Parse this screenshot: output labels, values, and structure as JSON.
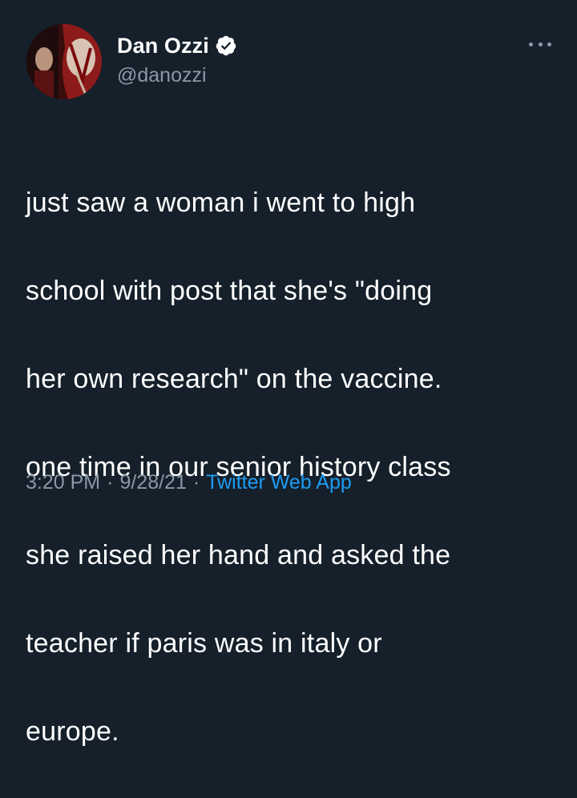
{
  "author": {
    "display_name": "Dan Ozzi",
    "handle": "@danozzi",
    "verified": true
  },
  "tweet": {
    "text_lines": [
      "just saw a woman i went to high",
      "school with post that she's \"doing",
      "her own research\" on the vaccine.",
      "one time in our senior history class",
      "she raised her hand and asked the",
      "teacher if paris was in italy or",
      "europe."
    ]
  },
  "meta": {
    "time": "3:20 PM",
    "separator": "·",
    "date": "9/28/21",
    "source": "Twitter Web App"
  },
  "colors": {
    "background": "#15202b",
    "secondary_text": "#8b98a5",
    "accent": "#1d9bf0"
  },
  "icons": {
    "verified": "verified-badge-icon",
    "more": "more-options-icon"
  }
}
